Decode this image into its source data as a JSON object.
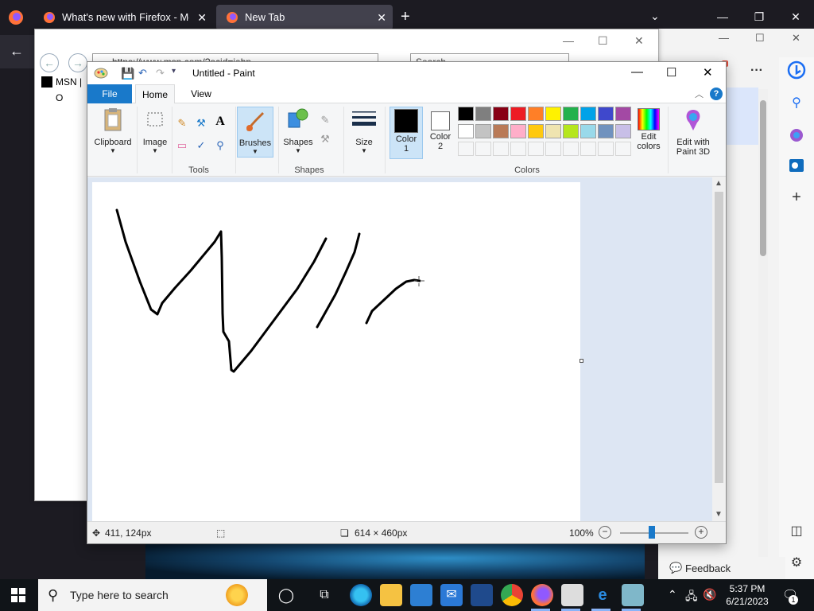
{
  "firefox": {
    "tabs": [
      {
        "label": "What's new with Firefox - More",
        "close": "✕"
      },
      {
        "label": "New Tab",
        "close": "✕"
      }
    ],
    "new_tab": "+",
    "tab_list": "⌄",
    "controls": {
      "min": "—",
      "max": "❐",
      "close": "✕"
    },
    "back": "←"
  },
  "ie": {
    "address": "https://www.msn.com/?ocid=iehp",
    "search_placeholder": "Search",
    "tab_label": "MSN | O",
    "controls": {
      "min": "—",
      "max": "☐",
      "close": "✕"
    },
    "back": "←",
    "forward": "→"
  },
  "edge": {
    "more": "···",
    "feedback_label": "Feedback",
    "controls": {
      "min": "—",
      "max": "☐",
      "close": "✕"
    }
  },
  "paint": {
    "title": "Untitled - Paint",
    "controls": {
      "min": "—",
      "max": "☐",
      "close": "✕"
    },
    "tabs": {
      "file": "File",
      "home": "Home",
      "view": "View"
    },
    "help": "?",
    "collapse": "︿",
    "ribbon": {
      "clipboard": "Clipboard",
      "image": "Image",
      "tools": "Tools",
      "brushes": "Brushes",
      "shapes_btn": "Shapes",
      "shapes_group": "Shapes",
      "size": "Size",
      "color1_line1": "Color",
      "color1_line2": "1",
      "color2_line1": "Color",
      "color2_line2": "2",
      "colors_group": "Colors",
      "edit_colors_line1": "Edit",
      "edit_colors_line2": "colors",
      "paint3d_line1": "Edit with",
      "paint3d_line2": "Paint 3D"
    },
    "palette_row1": [
      "#000000",
      "#7f7f7f",
      "#880015",
      "#ed1c24",
      "#ff7f27",
      "#fff200",
      "#22b14c",
      "#00a2e8",
      "#3f48cc",
      "#a349a4"
    ],
    "palette_row2": [
      "#ffffff",
      "#c3c3c3",
      "#b97a57",
      "#ffaec9",
      "#ffc90e",
      "#efe4b0",
      "#b5e61d",
      "#99d9ea",
      "#7092be",
      "#c8bfe7"
    ],
    "color1": "#000000",
    "color2": "#ffffff",
    "status": {
      "cursor_pos": "411, 124px",
      "canvas_size": "614 × 460px",
      "zoom": "100%"
    }
  },
  "taskbar": {
    "search_placeholder": "Type here to search",
    "time": "5:37 PM",
    "date": "6/21/2023",
    "notification_count": "1"
  }
}
